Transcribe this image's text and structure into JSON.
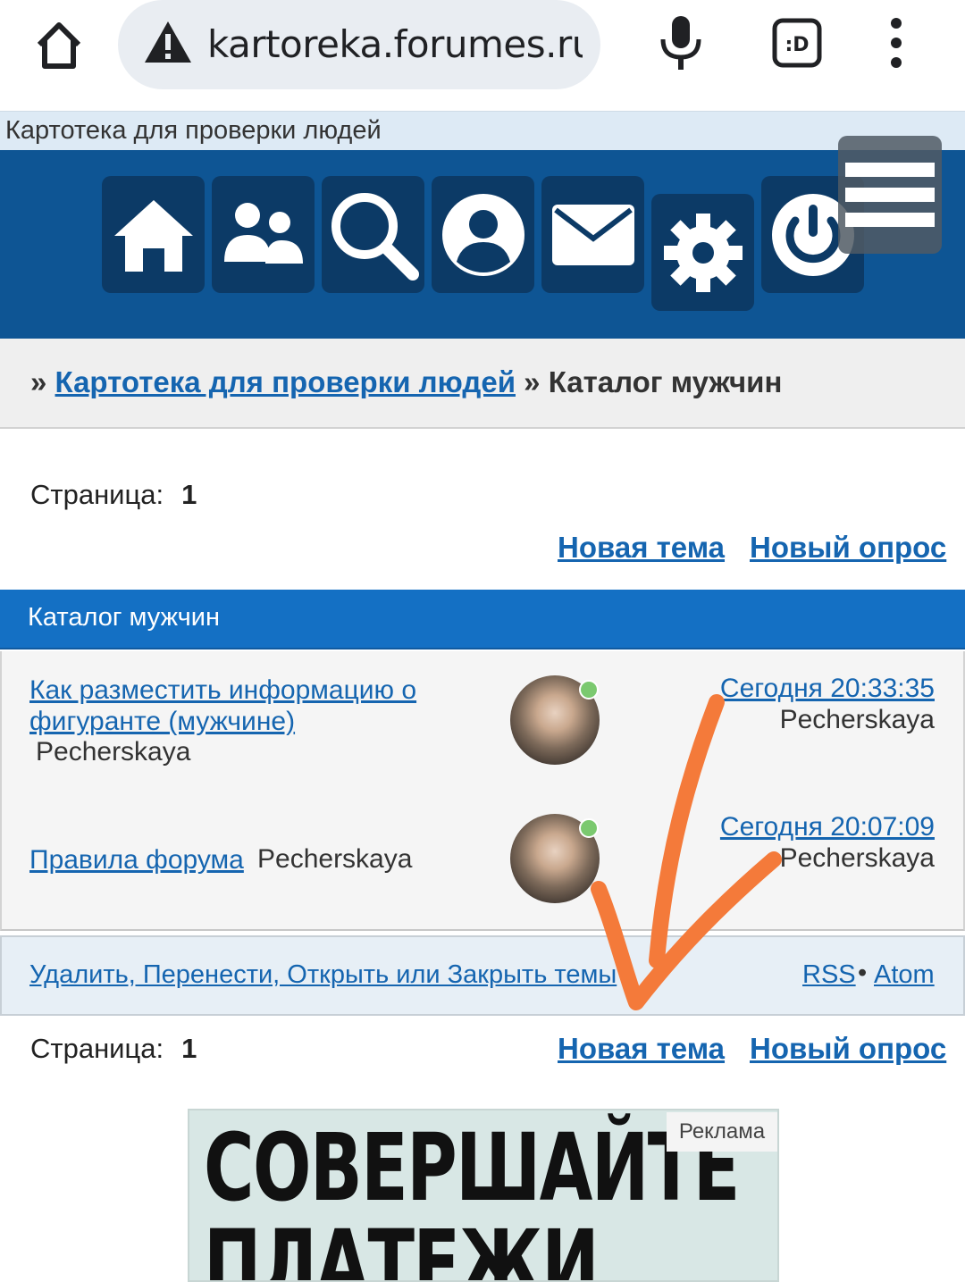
{
  "browser": {
    "url": "kartoreka.forumes.ru/",
    "icons": [
      "home-icon",
      "warning-icon",
      "mic-icon",
      "extension-icon",
      "more-vert-icon"
    ]
  },
  "site": {
    "title": "Картотека для проверки людей",
    "nav_icons": [
      "home-icon",
      "users-icon",
      "search-icon",
      "profile-icon",
      "messages-icon",
      "settings-icon",
      "logout-icon",
      "hamburger-icon"
    ],
    "nav_color": "#0e5594"
  },
  "breadcrumb": {
    "prefix": "»",
    "link": "Картотека для проверки людей",
    "separator": "»",
    "current": "Каталог мужчин"
  },
  "pagination_top": {
    "label": "Страница:",
    "page": "1"
  },
  "actions": {
    "new_topic": "Новая тема",
    "new_poll": "Новый опрос"
  },
  "forum": {
    "header": "Каталог мужчин",
    "topics": [
      {
        "title": "Как разместить информацию о фигуранте (мужчине)",
        "author": "Pecherskaya",
        "last_post_date": "Сегодня 20:33:35",
        "last_post_author": "Pecherskaya"
      },
      {
        "title": "Правила форума",
        "author": "Pecherskaya",
        "last_post_date": "Сегодня 20:07:09",
        "last_post_author": "Pecherskaya"
      }
    ]
  },
  "mod_bar": {
    "link": "Удалить, Перенести, Открыть или Закрыть темы",
    "rss": "RSS",
    "separator": "•",
    "atom": "Atom"
  },
  "pagination_bottom": {
    "label": "Страница:",
    "page": "1"
  },
  "ad": {
    "label": "Реклама",
    "headline_line1": "СОВЕРШАЙТЕ",
    "headline_line2": "ПЛАТЕЖИ"
  },
  "annotation": {
    "color": "#f47a3a"
  }
}
